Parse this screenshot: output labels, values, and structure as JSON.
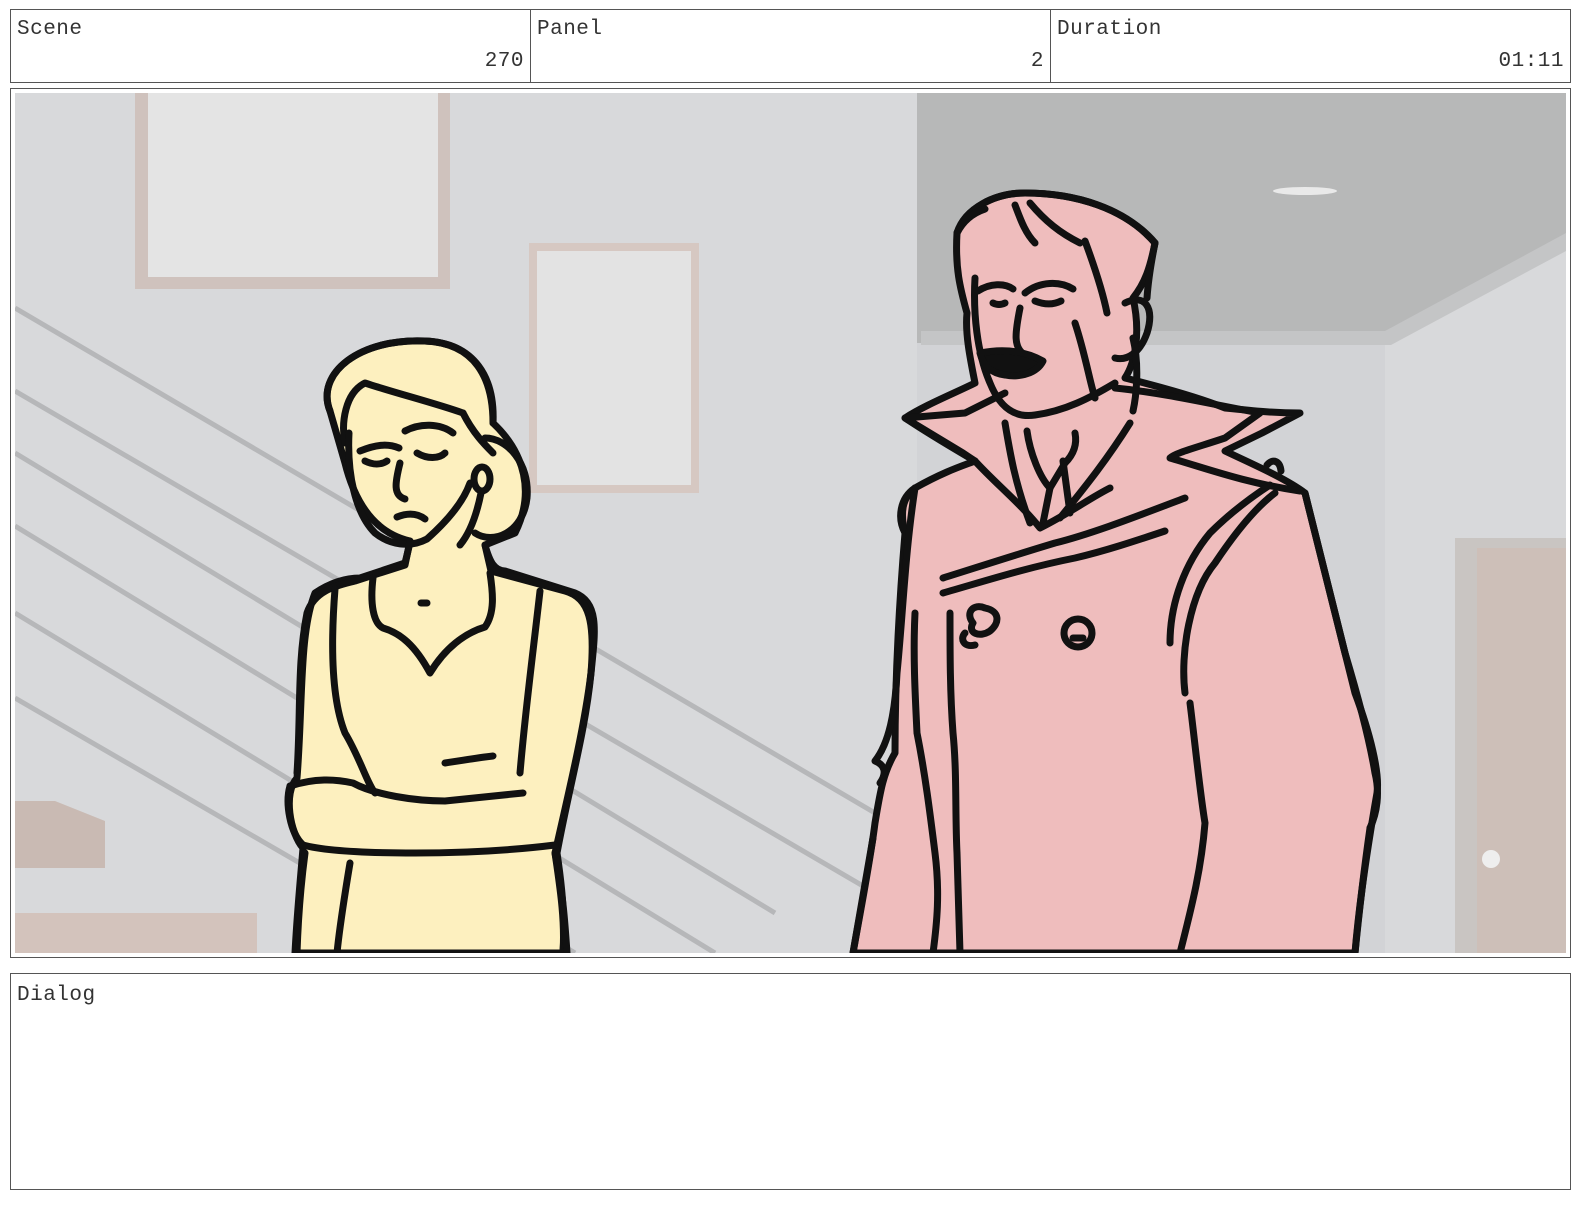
{
  "header": {
    "scene_label": "Scene",
    "scene_value": "270",
    "panel_label": "Panel",
    "panel_value": "2",
    "duration_label": "Duration",
    "duration_value": "01:11"
  },
  "dialog": {
    "label": "Dialog",
    "text": ""
  },
  "colors": {
    "woman_fill": "#fdf0bf",
    "man_fill": "#efbdbd",
    "wall": "#d9dadc",
    "ceiling": "#b8b9b9",
    "ink": "#111111"
  }
}
